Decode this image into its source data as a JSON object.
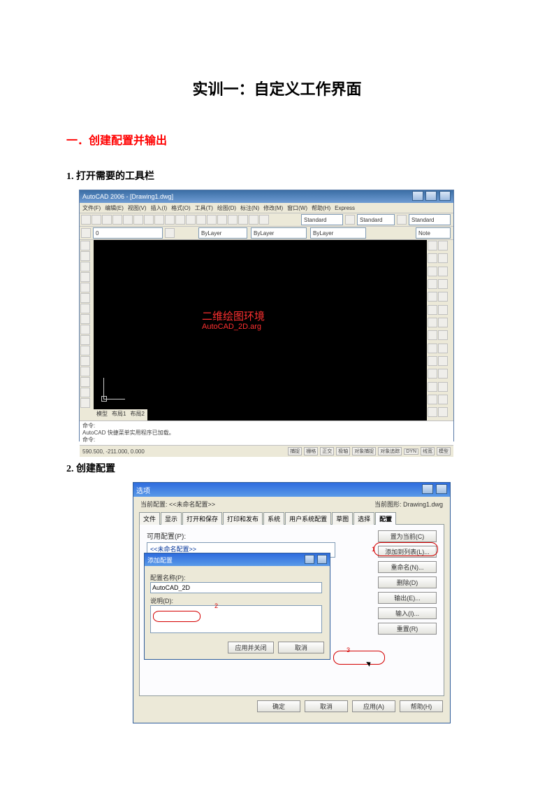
{
  "title": "实训一：自定义工作界面",
  "section1": "一．创建配置并输出",
  "step1": "1.  打开需要的工具栏",
  "step2": "2.  创建配置",
  "acad": {
    "title": "AutoCAD 2006 - [Drawing1.dwg]",
    "menu": [
      "文件(F)",
      "编辑(E)",
      "视图(V)",
      "插入(I)",
      "格式(O)",
      "工具(T)",
      "绘图(D)",
      "标注(N)",
      "修改(M)",
      "窗口(W)",
      "帮助(H)",
      "Express"
    ],
    "layerDrop": "0",
    "colorDrop": "ByLayer",
    "lineDrop": "ByLayer",
    "lwDrop": "ByLayer",
    "styleDrop1": "Standard",
    "styleDrop2": "Standard",
    "noteDrop": "Note",
    "canvas_main": "二维绘图环境",
    "canvas_sub": "AutoCAD_2D.arg",
    "tabs": [
      "模型",
      "布局1",
      "布局2"
    ],
    "cmd_line1": "命令:",
    "cmd_line2": "AutoCAD 快捷菜单实用程序已加载。",
    "cmd_line3": "命令:",
    "coords": "590.500, -211.000, 0.000",
    "status_btns": [
      "捕捉",
      "栅格",
      "正交",
      "极轴",
      "对象捕捉",
      "对象追踪",
      "DYN",
      "线宽",
      "模型"
    ]
  },
  "dlg": {
    "title": "选项",
    "current_profile_label": "当前配置:",
    "current_profile_value": "<<未命名配置>>",
    "file_icon_label": "当前图形:",
    "drawing": "Drawing1.dwg",
    "tabs": [
      "文件",
      "显示",
      "打开和保存",
      "打印和发布",
      "系统",
      "用户系统配置",
      "草图",
      "选择",
      "配置"
    ],
    "active_tab_index": 8,
    "avail_label": "可用配置(P):",
    "avail_item": "<<未命名配置>>",
    "btns": [
      "置为当前(C)",
      "添加到列表(L)...",
      "重命名(N)...",
      "删除(D)",
      "输出(E)...",
      "输入(I)...",
      "重置(R)"
    ],
    "callout1": "1",
    "callout2": "2",
    "callout3": "3",
    "footer": [
      "确定",
      "取消",
      "应用(A)",
      "帮助(H)"
    ]
  },
  "add": {
    "title": "添加配置",
    "name_label": "配置名称(P):",
    "name_value": "AutoCAD_2D",
    "desc_label": "说明(D):",
    "apply_close": "应用并关闭",
    "cancel": "取消"
  }
}
